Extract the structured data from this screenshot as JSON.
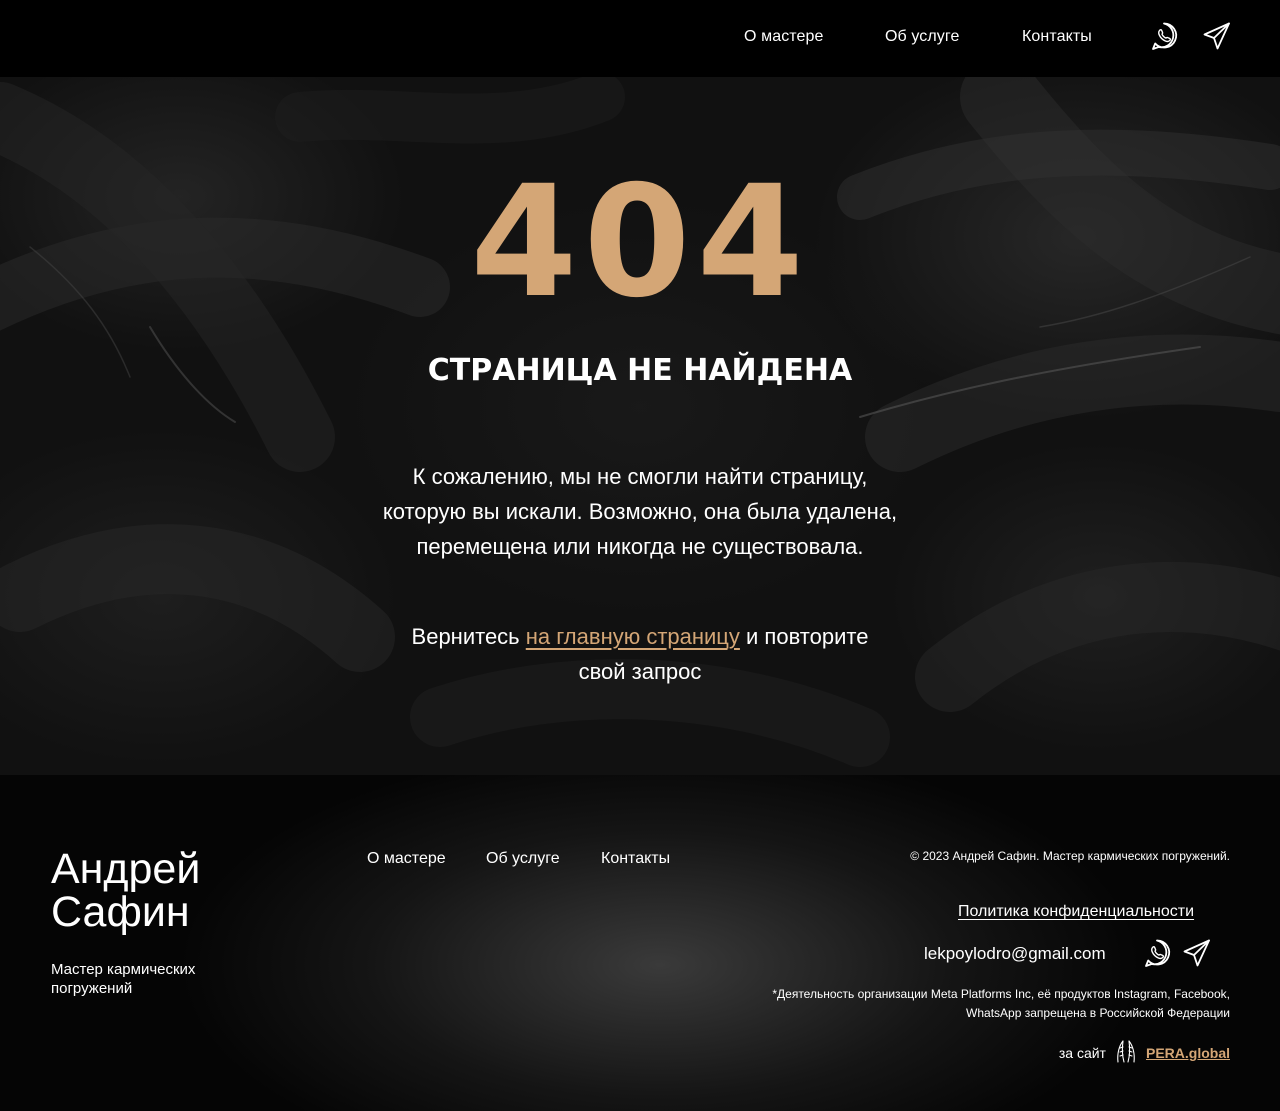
{
  "header": {
    "nav": [
      "О мастере",
      "Об услуге",
      "Контакты"
    ],
    "icons": [
      "whatsapp-icon",
      "telegram-icon"
    ]
  },
  "hero": {
    "code": "404",
    "title": "СТРАНИЦА НЕ НАЙДЕНА",
    "message_lines": [
      "К сожалению, мы не смогли найти страницу,",
      "которую вы искали. Возможно, она была удалена,",
      "перемещена или никогда не существовала."
    ],
    "back_prefix": "Вернитесь ",
    "back_link": "на главную страницу",
    "back_suffix_1": " и повторите",
    "back_suffix_2": "свой запрос"
  },
  "footer": {
    "brand_line1": "Андрей",
    "brand_line2": "Сафин",
    "brand_sub_line1": "Мастер кармических",
    "brand_sub_line2": "погружений",
    "nav": [
      "О мастере",
      "Об услуге",
      "Контакты"
    ],
    "copyright": "© 2023 Андрей Сафин. Мастер кармических погружений.",
    "policy": "Политика конфиденциальности",
    "email": "lekpoylodro@gmail.com",
    "disclaimer_line1": "*Деятельность организации Meta Platforms Inc, её продуктов Instagram, Facebook,",
    "disclaimer_line2": "WhatsApp запрещена в Российской Федерации",
    "credit_prefix": "за сайт",
    "credit_link": "PERA.global"
  },
  "colors": {
    "accent": "#d4a676",
    "background": "#000000",
    "text": "#ffffff"
  }
}
